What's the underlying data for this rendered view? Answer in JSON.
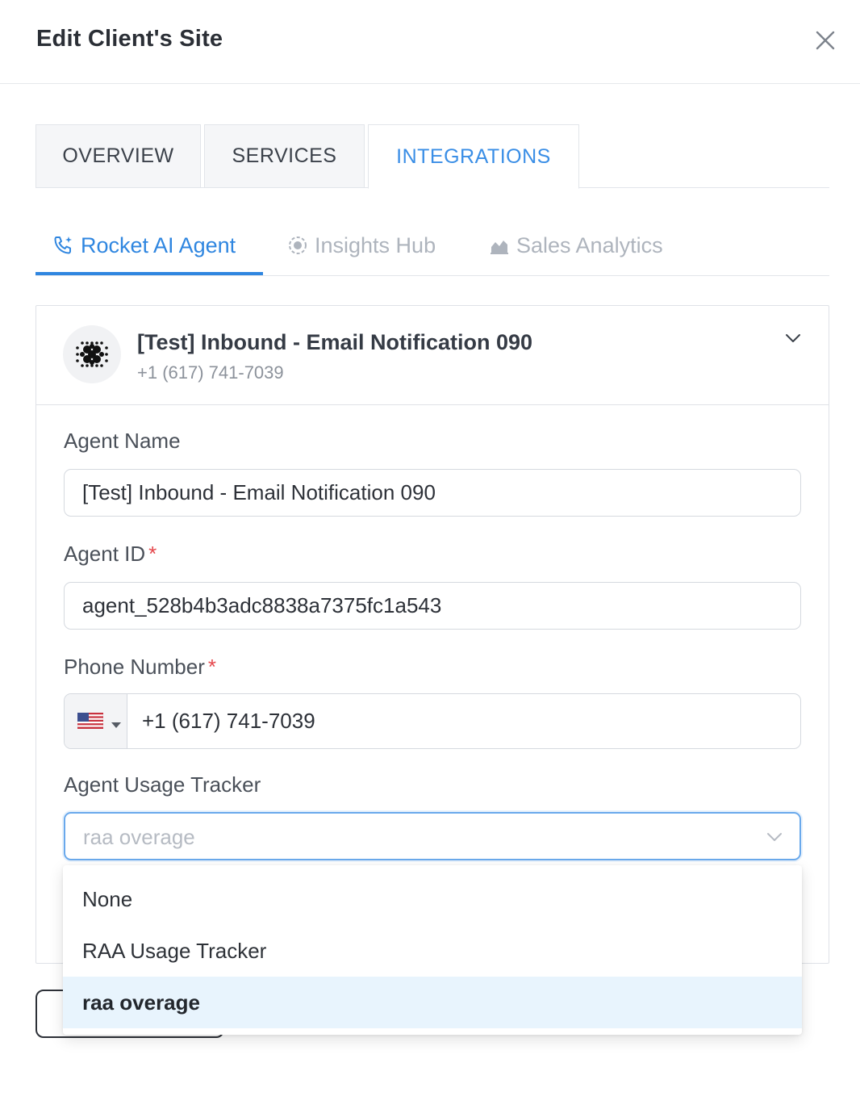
{
  "modal": {
    "title": "Edit Client's Site"
  },
  "tabs": [
    {
      "label": "OVERVIEW",
      "active": false
    },
    {
      "label": "SERVICES",
      "active": false
    },
    {
      "label": "INTEGRATIONS",
      "active": true
    }
  ],
  "subtabs": [
    {
      "label": "Rocket AI Agent",
      "icon": "phone-sparkle-icon",
      "active": true
    },
    {
      "label": "Insights Hub",
      "icon": "target-icon",
      "active": false
    },
    {
      "label": "Sales Analytics",
      "icon": "chart-area-icon",
      "active": false
    }
  ],
  "agent_card": {
    "title": "[Test] Inbound - Email Notification 090",
    "phone": "+1 (617) 741-7039",
    "avatar_icon": "dot-grid-logo-icon",
    "expanded": true
  },
  "form": {
    "agent_name": {
      "label": "Agent Name",
      "value": "[Test] Inbound - Email Notification 090"
    },
    "agent_id": {
      "label": "Agent ID",
      "required_mark": "*",
      "value": "agent_528b4b3adc8838a7375fc1a543"
    },
    "phone_number": {
      "label": "Phone Number",
      "required_mark": "*",
      "country": "US",
      "value": "+1 (617) 741-7039"
    },
    "usage_tracker": {
      "label": "Agent Usage Tracker",
      "placeholder": "raa overage"
    }
  },
  "dropdown": {
    "options": [
      {
        "label": "None",
        "selected": false
      },
      {
        "label": "RAA Usage Tracker",
        "selected": false
      },
      {
        "label": "raa overage",
        "selected": true
      }
    ]
  },
  "colors": {
    "accent": "#2f86e0",
    "required": "#e5484d",
    "selected_option_bg": "#e8f4fd",
    "focus_border": "#6aa9ec"
  }
}
